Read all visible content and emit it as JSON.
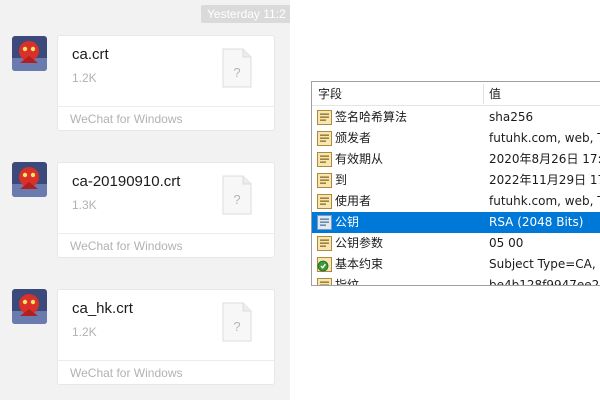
{
  "chat": {
    "timestamp": "Yesterday 11:2",
    "messages": [
      {
        "file_name": "ca.crt",
        "file_size": "1.2K",
        "source": "WeChat for Windows",
        "file_icon": "unknown-file-icon"
      },
      {
        "file_name": "ca-20190910.crt",
        "file_size": "1.3K",
        "source": "WeChat for Windows",
        "file_icon": "unknown-file-icon"
      },
      {
        "file_name": "ca_hk.crt",
        "file_size": "1.2K",
        "source": "WeChat for Windows",
        "file_icon": "unknown-file-icon"
      }
    ]
  },
  "certificate": {
    "columns": {
      "field": "字段",
      "value": "值"
    },
    "rows": [
      {
        "field": "签名哈希算法",
        "value": "sha256",
        "icon": "certificate-field-icon"
      },
      {
        "field": "颁发者",
        "value": "futuhk.com, web, TI",
        "icon": "certificate-field-icon"
      },
      {
        "field": "有效期从",
        "value": "2020年8月26日 17:2",
        "icon": "certificate-field-icon"
      },
      {
        "field": "到",
        "value": "2022年11月29日 17",
        "icon": "certificate-field-icon"
      },
      {
        "field": "使用者",
        "value": "futuhk.com, web, TI",
        "icon": "certificate-field-icon"
      },
      {
        "field": "公钥",
        "value": "RSA (2048 Bits)",
        "icon": "public-key-icon",
        "selected": true
      },
      {
        "field": "公钥参数",
        "value": "05 00",
        "icon": "certificate-field-icon"
      },
      {
        "field": "基本约束",
        "value": "Subject Type=CA, P",
        "icon": "extension-critical-icon"
      },
      {
        "field": "指纹",
        "value": "be4b128f9947ee2",
        "icon": "certificate-field-icon"
      }
    ]
  },
  "colors": {
    "selection": "#0078d7",
    "chat_background": "#f2f2f2",
    "muted_text": "#b2b2b2"
  }
}
